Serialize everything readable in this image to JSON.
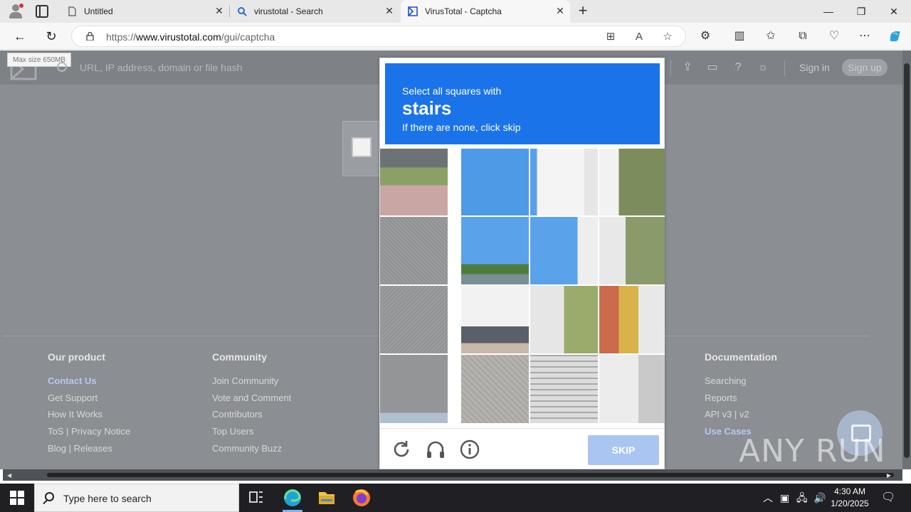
{
  "browser": {
    "tabs": [
      {
        "title": "Untitled",
        "active": false
      },
      {
        "title": "virustotal - Search",
        "active": false
      },
      {
        "title": "VirusTotal - Captcha",
        "active": true
      }
    ],
    "url_prefix": "https://",
    "url_domain": "www.virustotal.com",
    "url_path": "/gui/captcha"
  },
  "vt": {
    "maxsize": "Max size 650MB",
    "search_placeholder": "URL, IP address, domain or file hash",
    "signin": "Sign in",
    "signup": "Sign up"
  },
  "footer": {
    "cols": [
      {
        "heading": "Our product",
        "links": [
          "Contact Us",
          "Get Support",
          "How It Works",
          "ToS | Privacy Notice",
          "Blog | Releases"
        ]
      },
      {
        "heading": "Community",
        "links": [
          "Join Community",
          "Vote and Comment",
          "Contributors",
          "Top Users",
          "Community Buzz"
        ]
      },
      {
        "heading": "Documentation",
        "links": [
          "Searching",
          "Reports",
          "API v3 | v2",
          "Use Cases"
        ]
      }
    ]
  },
  "watermark": "ANY RUN",
  "captcha": {
    "line1": "Select all squares with",
    "target": "stairs",
    "line3": "If there are none, click skip",
    "skip": "SKIP",
    "banner_color": "#1a73e8"
  },
  "taskbar": {
    "search_text": "Type here to search",
    "time": "4:30 AM",
    "date": "1/20/2025"
  }
}
